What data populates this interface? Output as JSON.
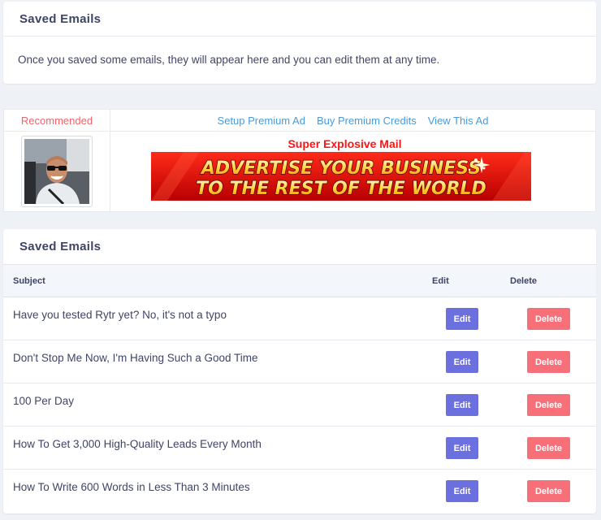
{
  "info_card": {
    "title": "Saved Emails",
    "message": "Once you saved some emails, they will appear here and you can edit them at any time."
  },
  "ad": {
    "recommended_label": "Recommended",
    "links": [
      "Setup Premium Ad",
      "Buy Premium Credits",
      "View This Ad"
    ],
    "ad_title": "Super Explosive Mail",
    "banner_lines": [
      "ADVERTISE YOUR BUSINESS",
      "TO THE REST OF THE WORLD"
    ]
  },
  "table_card": {
    "title": "Saved Emails",
    "columns": [
      "Subject",
      "Edit",
      "Delete"
    ],
    "edit_label": "Edit",
    "delete_label": "Delete",
    "rows": [
      {
        "subject": "Have you tested Rytr yet? No, it's not a typo"
      },
      {
        "subject": "Don't Stop Me Now, I'm Having Such a Good Time"
      },
      {
        "subject": "100 Per Day"
      },
      {
        "subject": "How To Get 3,000 High-Quality Leads Every Month"
      },
      {
        "subject": "How To Write 600 Words in Less Than 3 Minutes"
      }
    ]
  },
  "colors": {
    "edit_button": "#6c70df",
    "delete_button": "#f76f78",
    "link": "#4a9ad8",
    "recommended": "#f0656a",
    "ad_title": "#ff1414"
  }
}
